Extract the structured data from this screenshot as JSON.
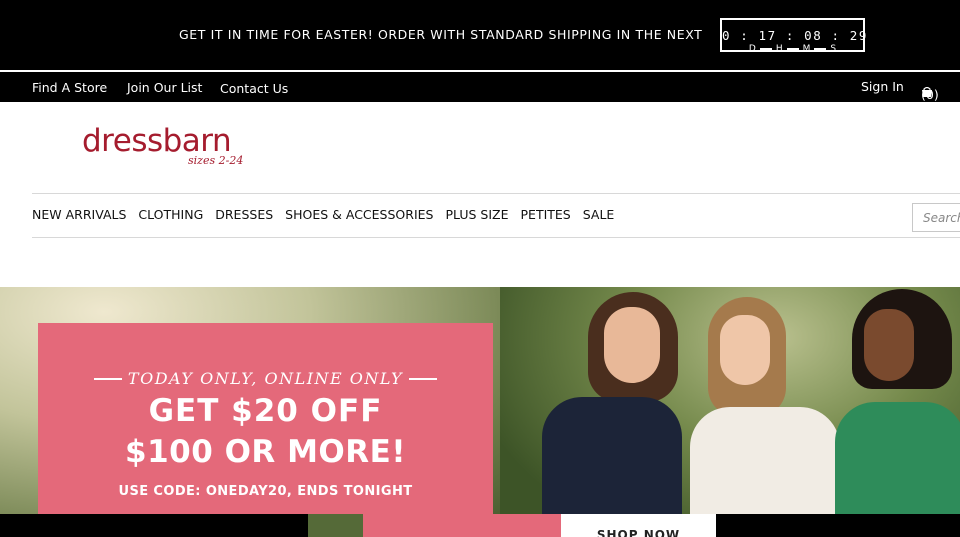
{
  "promo_bar": {
    "message": "GET IT IN TIME FOR EASTER! ORDER WITH STANDARD SHIPPING IN THE NEXT",
    "countdown": {
      "value": "0 : 17 : 08 : 29",
      "labels": [
        "D",
        "H",
        "M",
        "S"
      ]
    }
  },
  "utility_nav": {
    "find_store": "Find A Store",
    "join_list": "Join Our List",
    "contact": "Contact Us",
    "sign_in": "Sign In",
    "cart_count": "(0)"
  },
  "logo": {
    "name": "dressbarn",
    "tagline": "sizes 2-24",
    "color": "#a51c2e"
  },
  "main_nav": {
    "items": [
      "NEW ARRIVALS",
      "CLOTHING",
      "DRESSES",
      "SHOES & ACCESSORIES",
      "PLUS SIZE",
      "PETITES",
      "SALE"
    ]
  },
  "search": {
    "placeholder": "Search"
  },
  "hero": {
    "kicker": "TODAY ONLY, ONLINE ONLY",
    "headline_1": "GET $20 OFF",
    "headline_2": "$100 OR MORE!",
    "subtext": "USE CODE: ONEDAY20, ENDS TONIGHT",
    "cta": "SHOP NOW",
    "panel_color": "#e4697a"
  }
}
